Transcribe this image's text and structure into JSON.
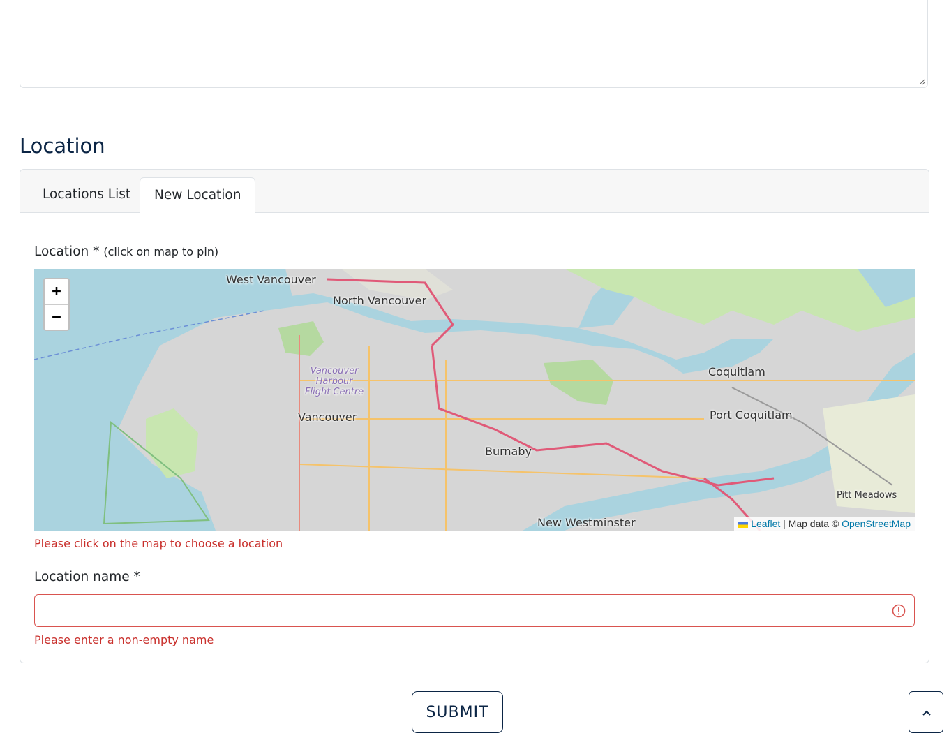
{
  "section": {
    "title": "Location"
  },
  "tabs": [
    {
      "label": "Locations List"
    },
    {
      "label": "New Location"
    }
  ],
  "map_field": {
    "label": "Location *",
    "hint": "(click on map to pin)",
    "error": "Please click on the map to choose a location"
  },
  "map": {
    "zoom_in": "+",
    "zoom_out": "−",
    "attribution": {
      "leaflet": "Leaflet",
      "separator": " | Map data © ",
      "osm": "OpenStreetMap"
    },
    "places": [
      "West Vancouver",
      "North Vancouver",
      "Vancouver",
      "Burnaby",
      "Coquitlam",
      "Port Coquitlam",
      "New Westminster",
      "Pitt Meadows"
    ],
    "airport": [
      "Vancouver",
      "Harbour",
      "Flight Centre"
    ]
  },
  "name_field": {
    "label": "Location name *",
    "value": "",
    "error": "Please enter a non-empty name"
  },
  "submit_label": "SUBMIT",
  "colors": {
    "primary": "#0b2545",
    "error": "#c9302c",
    "water": "#aad3df",
    "land": "#d3d3d3",
    "park": "#c8e6b0"
  },
  "icons": [
    "resize-handle-icon",
    "alert-circle-icon",
    "chevron-up-icon",
    "ukraine-flag-icon"
  ]
}
